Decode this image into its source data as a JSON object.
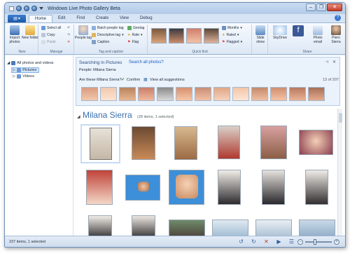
{
  "window": {
    "title": "Windows Live Photo Gallery Beta",
    "win_buttons": [
      "–",
      "❐",
      "✕"
    ]
  },
  "tabs": [
    "Home",
    "Edit",
    "Find",
    "Create",
    "View",
    "Debug"
  ],
  "help_label": "?",
  "ribbon": {
    "new_group": {
      "label": "New",
      "import": "Import photos",
      "new_folder": "New folder"
    },
    "manage_group": {
      "label": "Manage",
      "select_all": "Select all",
      "copy": "Copy",
      "paste": "Paste"
    },
    "tag_group": {
      "label": "Tag and caption",
      "people_tag": "People tag",
      "batch": "Batch people tag",
      "descriptive": "Descriptive tag",
      "caption": "Caption",
      "geotag": "Geotag",
      "rate": "Rate",
      "flag": "Flag"
    },
    "quickfind_group": {
      "label": "Quick find",
      "months": "Months",
      "rated": "Rated",
      "flagged": "Flagged"
    },
    "share_group": {
      "label": "Share",
      "slide_show": "Slide show",
      "skydrive": "SkyDrive",
      "photo_email": "Photo email",
      "user": "Piero Sierra"
    }
  },
  "nav": {
    "all": "All photos and videos",
    "pictures": "Pictures",
    "videos": "Videos"
  },
  "search": {
    "searching_in": "Searching in Pictures",
    "search_all": "Search all photos?",
    "people_label": "People: Milana Sierra",
    "question": "Are these Milana Sierra?",
    "confirm": "Confirm",
    "view_all": "View all suggestions",
    "count": "13 of 207"
  },
  "heading": {
    "name": "Milana Sierra",
    "sub": "(28 items, 1 selected)"
  },
  "status": {
    "text": "237 items, 1 selected"
  },
  "colors": {
    "accent": "#3b6fb0",
    "frame": "#dfe9f5",
    "selection": "#cfe3fa"
  }
}
